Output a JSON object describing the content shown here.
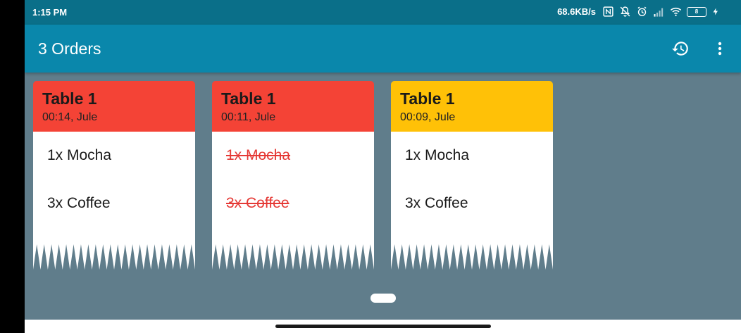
{
  "status_bar": {
    "time": "1:15 PM",
    "network_speed": "68.6KB/s",
    "battery_level": "8",
    "icons": [
      "nfc-icon",
      "mute-icon",
      "alarm-icon",
      "signal-icon",
      "wifi-icon",
      "battery-icon",
      "charging-icon"
    ]
  },
  "app_bar": {
    "title": "3 Orders",
    "actions": [
      "history-icon",
      "more-vert-icon"
    ]
  },
  "colors": {
    "status_bar": "#0a6f89",
    "app_bar": "#0a87ab",
    "background": "#607d8b",
    "urgent": "#f44336",
    "warning": "#ffc107",
    "done_text": "#e53935"
  },
  "orders": [
    {
      "table": "Table 1",
      "meta": "00:14, Jule",
      "status": "urgent",
      "items": [
        {
          "text": "1x Mocha",
          "done": false
        },
        {
          "text": "3x Coffee",
          "done": false
        }
      ]
    },
    {
      "table": "Table 1",
      "meta": "00:11, Jule",
      "status": "urgent",
      "items": [
        {
          "text": "1x Mocha",
          "done": true
        },
        {
          "text": "3x Coffee",
          "done": true
        }
      ]
    },
    {
      "table": "Table 1",
      "meta": "00:09, Jule",
      "status": "warning",
      "items": [
        {
          "text": "1x Mocha",
          "done": false
        },
        {
          "text": "3x Coffee",
          "done": false
        }
      ]
    }
  ]
}
